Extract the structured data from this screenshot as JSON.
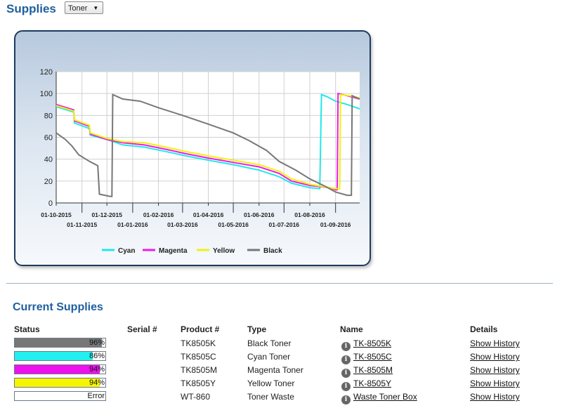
{
  "header": {
    "title": "Supplies",
    "dropdown": {
      "selected": "Toner"
    }
  },
  "chart_data": {
    "type": "line",
    "xlim": [
      "2015-10-01",
      "2016-09-30"
    ],
    "ylim": [
      0,
      120
    ],
    "yticks": [
      0,
      20,
      40,
      60,
      80,
      100,
      120
    ],
    "xticks": [
      {
        "date": "2015-10-01",
        "label": "01-10-2015",
        "row": 0
      },
      {
        "date": "2015-11-01",
        "label": "01-11-2015",
        "row": 1
      },
      {
        "date": "2015-12-01",
        "label": "01-12-2015",
        "row": 0
      },
      {
        "date": "2016-01-01",
        "label": "01-01-2016",
        "row": 1
      },
      {
        "date": "2016-02-01",
        "label": "01-02-2016",
        "row": 0
      },
      {
        "date": "2016-03-01",
        "label": "01-03-2016",
        "row": 1
      },
      {
        "date": "2016-04-01",
        "label": "01-04-2016",
        "row": 0
      },
      {
        "date": "2016-05-01",
        "label": "01-05-2016",
        "row": 1
      },
      {
        "date": "2016-06-01",
        "label": "01-06-2016",
        "row": 0
      },
      {
        "date": "2016-07-01",
        "label": "01-07-2016",
        "row": 1
      },
      {
        "date": "2016-08-01",
        "label": "01-08-2016",
        "row": 0
      },
      {
        "date": "2016-09-01",
        "label": "01-09-2016",
        "row": 1
      }
    ],
    "grid": true,
    "legend_position": "bottom",
    "series": [
      {
        "name": "Cyan",
        "color": "#22e8ea",
        "points": [
          [
            "2015-10-01",
            88
          ],
          [
            "2015-10-22",
            83
          ],
          [
            "2015-10-23",
            73
          ],
          [
            "2015-11-10",
            68
          ],
          [
            "2015-11-11",
            62
          ],
          [
            "2015-12-01",
            58
          ],
          [
            "2015-12-20",
            53
          ],
          [
            "2016-01-15",
            51
          ],
          [
            "2016-02-10",
            47
          ],
          [
            "2016-03-05",
            43
          ],
          [
            "2016-04-01",
            39
          ],
          [
            "2016-05-01",
            35
          ],
          [
            "2016-06-01",
            30
          ],
          [
            "2016-06-25",
            24
          ],
          [
            "2016-07-10",
            18
          ],
          [
            "2016-08-01",
            14
          ],
          [
            "2016-08-13",
            13
          ],
          [
            "2016-08-15",
            99
          ],
          [
            "2016-08-22",
            97
          ],
          [
            "2016-09-01",
            93
          ],
          [
            "2016-09-15",
            90
          ],
          [
            "2016-09-30",
            86
          ]
        ]
      },
      {
        "name": "Magenta",
        "color": "#ee1ae9",
        "points": [
          [
            "2015-10-01",
            90
          ],
          [
            "2015-10-22",
            85
          ],
          [
            "2015-10-23",
            75
          ],
          [
            "2015-11-10",
            70
          ],
          [
            "2015-11-11",
            63
          ],
          [
            "2015-12-01",
            58
          ],
          [
            "2015-12-20",
            55
          ],
          [
            "2016-01-15",
            53
          ],
          [
            "2016-02-10",
            49
          ],
          [
            "2016-03-05",
            45
          ],
          [
            "2016-04-01",
            41
          ],
          [
            "2016-05-01",
            37
          ],
          [
            "2016-06-01",
            33
          ],
          [
            "2016-06-25",
            27
          ],
          [
            "2016-07-10",
            20
          ],
          [
            "2016-08-01",
            16
          ],
          [
            "2016-08-25",
            14
          ],
          [
            "2016-09-01",
            12
          ],
          [
            "2016-09-03",
            12
          ],
          [
            "2016-09-04",
            100
          ],
          [
            "2016-09-15",
            98
          ],
          [
            "2016-09-30",
            95
          ]
        ]
      },
      {
        "name": "Yellow",
        "color": "#f2f20a",
        "points": [
          [
            "2015-10-01",
            89
          ],
          [
            "2015-10-22",
            84
          ],
          [
            "2015-10-23",
            76
          ],
          [
            "2015-11-10",
            71
          ],
          [
            "2015-11-11",
            64
          ],
          [
            "2015-12-01",
            59
          ],
          [
            "2015-12-20",
            56
          ],
          [
            "2016-01-15",
            55
          ],
          [
            "2016-02-10",
            51
          ],
          [
            "2016-03-05",
            47
          ],
          [
            "2016-04-01",
            43
          ],
          [
            "2016-05-01",
            39
          ],
          [
            "2016-06-01",
            35
          ],
          [
            "2016-06-25",
            29
          ],
          [
            "2016-07-10",
            22
          ],
          [
            "2016-08-01",
            17
          ],
          [
            "2016-09-01",
            13
          ],
          [
            "2016-09-06",
            13
          ],
          [
            "2016-09-07",
            99
          ],
          [
            "2016-09-18",
            98
          ],
          [
            "2016-09-30",
            96
          ]
        ]
      },
      {
        "name": "Black",
        "color": "#777777",
        "points": [
          [
            "2015-10-01",
            64
          ],
          [
            "2015-10-12",
            58
          ],
          [
            "2015-10-20",
            52
          ],
          [
            "2015-10-28",
            44
          ],
          [
            "2015-11-10",
            38
          ],
          [
            "2015-11-20",
            34
          ],
          [
            "2015-11-22",
            8
          ],
          [
            "2015-12-05",
            6
          ],
          [
            "2015-12-07",
            6
          ],
          [
            "2015-12-08",
            99
          ],
          [
            "2015-12-20",
            95
          ],
          [
            "2016-01-10",
            93
          ],
          [
            "2016-02-01",
            87
          ],
          [
            "2016-03-01",
            80
          ],
          [
            "2016-04-01",
            72
          ],
          [
            "2016-05-01",
            64
          ],
          [
            "2016-05-20",
            57
          ],
          [
            "2016-06-10",
            48
          ],
          [
            "2016-06-25",
            38
          ],
          [
            "2016-07-15",
            30
          ],
          [
            "2016-08-01",
            22
          ],
          [
            "2016-08-20",
            15
          ],
          [
            "2016-09-01",
            10
          ],
          [
            "2016-09-15",
            7
          ],
          [
            "2016-09-20",
            7
          ],
          [
            "2016-09-21",
            98
          ],
          [
            "2016-09-30",
            95
          ]
        ]
      }
    ]
  },
  "section_title": "Current Supplies",
  "columns": {
    "status": "Status",
    "serial": "Serial #",
    "product": "Product #",
    "type": "Type",
    "name": "Name",
    "details": "Details"
  },
  "supplies": [
    {
      "level": 96,
      "level_text": "96%",
      "fill": "#777777",
      "serial": "",
      "product": "TK8505K",
      "type": "Black Toner",
      "name": "TK-8505K",
      "details": "Show History"
    },
    {
      "level": 86,
      "level_text": "86%",
      "fill": "#22f0f0",
      "serial": "",
      "product": "TK8505C",
      "type": "Cyan Toner",
      "name": "TK-8505C",
      "details": "Show History"
    },
    {
      "level": 94,
      "level_text": "94%",
      "fill": "#ee10ee",
      "serial": "",
      "product": "TK8505M",
      "type": "Magenta Toner",
      "name": "TK-8505M",
      "details": "Show History"
    },
    {
      "level": 94,
      "level_text": "94%",
      "fill": "#f5f500",
      "serial": "",
      "product": "TK8505Y",
      "type": "Yellow Toner",
      "name": "TK-8505Y",
      "details": "Show History"
    },
    {
      "level": 0,
      "level_text": "Error",
      "fill": "#ffffff",
      "serial": "",
      "product": "WT-860",
      "type": "Toner Waste",
      "name": "Waste Toner Box",
      "details": "Show History"
    }
  ]
}
